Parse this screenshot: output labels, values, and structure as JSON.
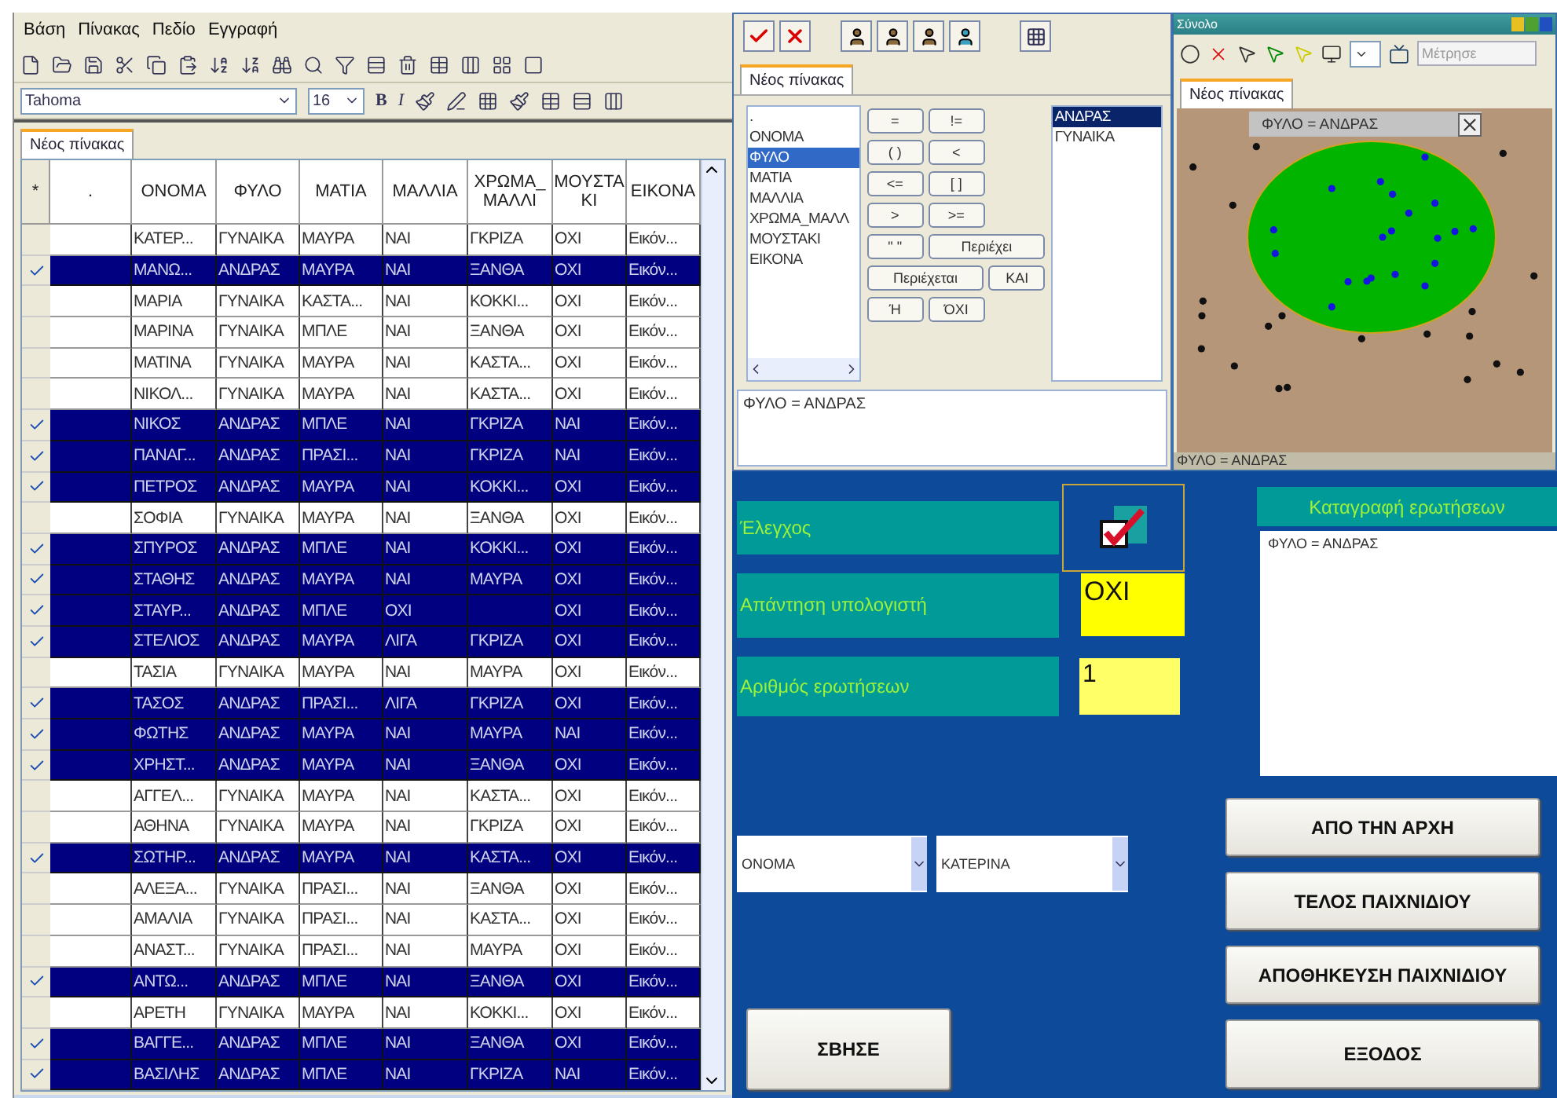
{
  "table_window": {
    "menu": [
      "Βάση",
      "Πίνακας",
      "Πεδίο",
      "Εγγραφή"
    ],
    "font_toolbar": {
      "font": "Tahoma",
      "size": "16",
      "style_buttons": [
        "B",
        "I"
      ]
    },
    "tabs": [
      {
        "label": "Νέος πίνακας",
        "selected": true
      }
    ],
    "table": {
      "selector_header": "*",
      "columns": [
        ".",
        "ΟΝΟΜΑ",
        "ΦΥΛΟ",
        "ΜΑΤΙΑ",
        "ΜΑΛΛΙΑ",
        "ΧΡΩΜΑ_ΜΑΛΛΙ",
        "ΜΟΥΣΤΑΚΙ",
        "ΕΙΚΟΝΑ"
      ],
      "rows": [
        {
          "selected": false,
          "cells": [
            "",
            "ΚΑΤΕΡ...",
            "ΓΥΝΑΙΚΑ",
            "ΜΑΥΡΑ",
            "ΝΑΙ",
            "ΓΚΡΙΖΑ",
            "ΟΧΙ",
            "Εικόν..."
          ]
        },
        {
          "selected": true,
          "cells": [
            "",
            "ΜΑΝΩ...",
            "ΑΝΔΡΑΣ",
            "ΜΑΥΡΑ",
            "ΝΑΙ",
            "ΞΑΝΘΑ",
            "ΟΧΙ",
            "Εικόν..."
          ]
        },
        {
          "selected": false,
          "cells": [
            "",
            "ΜΑΡΙΑ",
            "ΓΥΝΑΙΚΑ",
            "ΚΑΣΤΑ...",
            "ΝΑΙ",
            "ΚΟΚΚΙ...",
            "ΟΧΙ",
            "Εικόν..."
          ]
        },
        {
          "selected": false,
          "cells": [
            "",
            "ΜΑΡΙΝΑ",
            "ΓΥΝΑΙΚΑ",
            "ΜΠΛΕ",
            "ΝΑΙ",
            "ΞΑΝΘΑ",
            "ΟΧΙ",
            "Εικόν..."
          ]
        },
        {
          "selected": false,
          "cells": [
            "",
            "ΜΑΤΙΝΑ",
            "ΓΥΝΑΙΚΑ",
            "ΜΑΥΡΑ",
            "ΝΑΙ",
            "ΚΑΣΤΑ...",
            "ΟΧΙ",
            "Εικόν..."
          ]
        },
        {
          "selected": false,
          "cells": [
            "",
            "ΝΙΚΟΛ...",
            "ΓΥΝΑΙΚΑ",
            "ΜΑΥΡΑ",
            "ΝΑΙ",
            "ΚΑΣΤΑ...",
            "ΟΧΙ",
            "Εικόν..."
          ]
        },
        {
          "selected": true,
          "cells": [
            "",
            "ΝΙΚΟΣ",
            "ΑΝΔΡΑΣ",
            "ΜΠΛΕ",
            "ΝΑΙ",
            "ΓΚΡΙΖΑ",
            "ΝΑΙ",
            "Εικόν..."
          ]
        },
        {
          "selected": true,
          "cells": [
            "",
            "ΠΑΝΑΓ...",
            "ΑΝΔΡΑΣ",
            "ΠΡΑΣΙ...",
            "ΝΑΙ",
            "ΓΚΡΙΖΑ",
            "ΝΑΙ",
            "Εικόν..."
          ]
        },
        {
          "selected": true,
          "cells": [
            "",
            "ΠΕΤΡΟΣ",
            "ΑΝΔΡΑΣ",
            "ΜΑΥΡΑ",
            "ΝΑΙ",
            "ΚΟΚΚΙ...",
            "ΟΧΙ",
            "Εικόν..."
          ]
        },
        {
          "selected": false,
          "cells": [
            "",
            "ΣΟΦΙΑ",
            "ΓΥΝΑΙΚΑ",
            "ΜΑΥΡΑ",
            "ΝΑΙ",
            "ΞΑΝΘΑ",
            "ΟΧΙ",
            "Εικόν..."
          ]
        },
        {
          "selected": true,
          "cells": [
            "",
            "ΣΠΥΡΟΣ",
            "ΑΝΔΡΑΣ",
            "ΜΠΛΕ",
            "ΝΑΙ",
            "ΚΟΚΚΙ...",
            "ΟΧΙ",
            "Εικόν..."
          ]
        },
        {
          "selected": true,
          "cells": [
            "",
            "ΣΤΑΘΗΣ",
            "ΑΝΔΡΑΣ",
            "ΜΑΥΡΑ",
            "ΝΑΙ",
            "ΜΑΥΡΑ",
            "ΟΧΙ",
            "Εικόν..."
          ]
        },
        {
          "selected": true,
          "cells": [
            "",
            "ΣΤΑΥΡ...",
            "ΑΝΔΡΑΣ",
            "ΜΠΛΕ",
            "ΟΧΙ",
            "",
            "ΟΧΙ",
            "Εικόν..."
          ]
        },
        {
          "selected": true,
          "cells": [
            "",
            "ΣΤΕΛΙΟΣ",
            "ΑΝΔΡΑΣ",
            "ΜΑΥΡΑ",
            "ΛΙΓΑ",
            "ΓΚΡΙΖΑ",
            "ΟΧΙ",
            "Εικόν..."
          ]
        },
        {
          "selected": false,
          "cells": [
            "",
            "ΤΑΣΙΑ",
            "ΓΥΝΑΙΚΑ",
            "ΜΑΥΡΑ",
            "ΝΑΙ",
            "ΜΑΥΡΑ",
            "ΟΧΙ",
            "Εικόν..."
          ]
        },
        {
          "selected": true,
          "cells": [
            "",
            "ΤΑΣΟΣ",
            "ΑΝΔΡΑΣ",
            "ΠΡΑΣΙ...",
            "ΛΙΓΑ",
            "ΓΚΡΙΖΑ",
            "ΟΧΙ",
            "Εικόν..."
          ]
        },
        {
          "selected": true,
          "cells": [
            "",
            "ΦΩΤΗΣ",
            "ΑΝΔΡΑΣ",
            "ΜΑΥΡΑ",
            "ΝΑΙ",
            "ΜΑΥΡΑ",
            "ΝΑΙ",
            "Εικόν..."
          ]
        },
        {
          "selected": true,
          "cells": [
            "",
            "ΧΡΗΣΤ...",
            "ΑΝΔΡΑΣ",
            "ΜΑΥΡΑ",
            "ΝΑΙ",
            "ΞΑΝΘΑ",
            "ΟΧΙ",
            "Εικόν..."
          ]
        },
        {
          "selected": false,
          "cells": [
            "",
            "ΑΓΓΕΛ...",
            "ΓΥΝΑΙΚΑ",
            "ΜΑΥΡΑ",
            "ΝΑΙ",
            "ΚΑΣΤΑ...",
            "ΟΧΙ",
            "Εικόν..."
          ]
        },
        {
          "selected": false,
          "cells": [
            "",
            "ΑΘΗΝΑ",
            "ΓΥΝΑΙΚΑ",
            "ΜΑΥΡΑ",
            "ΝΑΙ",
            "ΓΚΡΙΖΑ",
            "ΟΧΙ",
            "Εικόν..."
          ]
        },
        {
          "selected": true,
          "cells": [
            "",
            "ΣΩΤΗΡ...",
            "ΑΝΔΡΑΣ",
            "ΜΑΥΡΑ",
            "ΝΑΙ",
            "ΚΑΣΤΑ...",
            "ΟΧΙ",
            "Εικόν..."
          ]
        },
        {
          "selected": false,
          "cells": [
            "",
            "ΑΛΕΞΑ...",
            "ΓΥΝΑΙΚΑ",
            "ΠΡΑΣΙ...",
            "ΝΑΙ",
            "ΞΑΝΘΑ",
            "ΟΧΙ",
            "Εικόν..."
          ]
        },
        {
          "selected": false,
          "cells": [
            "",
            "ΑΜΑΛΙΑ",
            "ΓΥΝΑΙΚΑ",
            "ΠΡΑΣΙ...",
            "ΝΑΙ",
            "ΚΑΣΤΑ...",
            "ΟΧΙ",
            "Εικόν..."
          ]
        },
        {
          "selected": false,
          "cells": [
            "",
            "ΑΝΑΣΤ...",
            "ΓΥΝΑΙΚΑ",
            "ΠΡΑΣΙ...",
            "ΝΑΙ",
            "ΜΑΥΡΑ",
            "ΟΧΙ",
            "Εικόν..."
          ]
        },
        {
          "selected": true,
          "cells": [
            "",
            "ΑΝΤΩ...",
            "ΑΝΔΡΑΣ",
            "ΜΠΛΕ",
            "ΝΑΙ",
            "ΞΑΝΘΑ",
            "ΟΧΙ",
            "Εικόν..."
          ]
        },
        {
          "selected": false,
          "cells": [
            "",
            "ΑΡΕΤΗ",
            "ΓΥΝΑΙΚΑ",
            "ΜΑΥΡΑ",
            "ΝΑΙ",
            "ΚΟΚΚΙ...",
            "ΟΧΙ",
            "Εικόν..."
          ]
        },
        {
          "selected": true,
          "cells": [
            "",
            "ΒΑΓΓΕ...",
            "ΑΝΔΡΑΣ",
            "ΜΠΛΕ",
            "ΝΑΙ",
            "ΞΑΝΘΑ",
            "ΟΧΙ",
            "Εικόν..."
          ]
        },
        {
          "selected": true,
          "cells": [
            "",
            "ΒΑΣΙΛΗΣ",
            "ΑΝΔΡΑΣ",
            "ΜΠΛΕ",
            "ΝΑΙ",
            "ΓΚΡΙΖΑ",
            "ΝΑΙ",
            "Εικόν..."
          ]
        }
      ]
    }
  },
  "query_window": {
    "tabs": [
      {
        "label": "Νέος πίνακας",
        "selected": true
      }
    ],
    "fields": [
      {
        "label": ".",
        "selected": false
      },
      {
        "label": "ΟΝΟΜΑ",
        "selected": false
      },
      {
        "label": "ΦΥΛΟ",
        "selected": true
      },
      {
        "label": "ΜΑΤΙΑ",
        "selected": false
      },
      {
        "label": "ΜΑΛΛΙΑ",
        "selected": false
      },
      {
        "label": "ΧΡΩΜΑ_ΜΑΛΛ",
        "selected": false
      },
      {
        "label": "ΜΟΥΣΤΑΚΙ",
        "selected": false
      },
      {
        "label": "ΕΙΚΟΝΑ",
        "selected": false
      }
    ],
    "operators": [
      "=",
      "!=",
      "( )",
      "<",
      "<=",
      "[ ]",
      ">",
      ">=",
      "\" \"",
      "Περιέχει",
      "Περιέχεται",
      "ΚΑΙ",
      "Ή",
      "ΌΧΙ"
    ],
    "values": [
      {
        "label": "ΑΝΔΡΑΣ",
        "selected": true
      },
      {
        "label": "ΓΥΝΑΙΚΑ",
        "selected": false
      }
    ],
    "expression": "ΦΥΛΟ = ΑΝΔΡΑΣ"
  },
  "set_window": {
    "title": "Σύνολο",
    "count_placeholder": "Μέτρησε",
    "tabs": [
      {
        "label": "Νέος πίνακας",
        "selected": true
      }
    ],
    "set_label": "ΦΥΛΟ = ΑΝΔΡΑΣ",
    "status": "ΦΥΛΟ = ΑΝΔΡΑΣ"
  },
  "game": {
    "check_label": "Έλεγχος",
    "answer_label": "Απάντηση υπολογιστή",
    "answer": "ΟΧΙ",
    "count_label": "Αριθμός ερωτήσεων",
    "count": "1",
    "log_title": "Καταγραφή ερωτήσεων",
    "log": [
      "ΦΥΛΟ = ΑΝΔΡΑΣ"
    ],
    "field_select": "ΟΝΟΜΑ",
    "value_select": "ΚΑΤΕΡΙΝΑ",
    "clear_button": "ΣΒΗΣΕ",
    "buttons": [
      "ΑΠΟ ΤΗΝ ΑΡΧΗ",
      "ΤΕΛΟΣ ΠΑΙΧΝΙΔΙΟΥ",
      "ΑΠΟΘΗΚΕΥΣΗ ΠΑΙΧΝΙΔΙΟΥ",
      "ΕΞΟΔΟΣ"
    ]
  }
}
